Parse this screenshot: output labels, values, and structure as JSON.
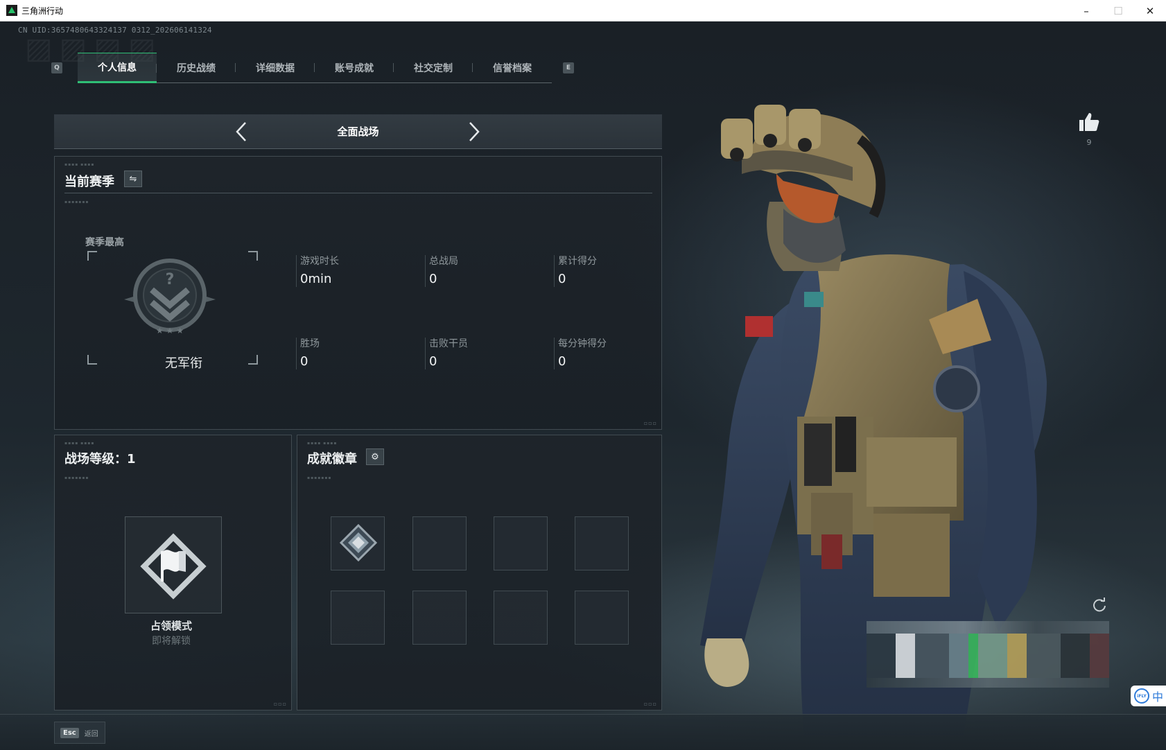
{
  "window": {
    "title": "三角洲行动",
    "controls": [
      "–",
      "☐",
      "✕"
    ]
  },
  "uid": "CN UID:3657480643324137 0312_202606141324",
  "tabs": {
    "left_key": "Q",
    "right_key": "E",
    "items": [
      {
        "label": "个人信息",
        "active": true
      },
      {
        "label": "历史战绩",
        "active": false
      },
      {
        "label": "详细数据",
        "active": false
      },
      {
        "label": "账号成就",
        "active": false
      },
      {
        "label": "社交定制",
        "active": false
      },
      {
        "label": "信誉档案",
        "active": false
      }
    ]
  },
  "mode_selector": {
    "title": "全面战场"
  },
  "season": {
    "title": "当前赛季",
    "best_label": "赛季最高",
    "rank_name": "无军衔",
    "stats": [
      {
        "label": "游戏时长",
        "value": "0min"
      },
      {
        "label": "总战局",
        "value": "0"
      },
      {
        "label": "累计得分",
        "value": "0"
      },
      {
        "label": "胜场",
        "value": "0"
      },
      {
        "label": "击败干员",
        "value": "0"
      },
      {
        "label": "每分钟得分",
        "value": "0"
      }
    ]
  },
  "level": {
    "title": "战场等级：1",
    "mode_name": "占领模式",
    "mode_status": "即将解锁"
  },
  "badges": {
    "title": "成就徽章",
    "slots": 8,
    "filled": 1
  },
  "operator": {
    "likes": "9"
  },
  "ime": {
    "logo": "iFLY",
    "text": "中"
  },
  "bottom": {
    "esc_key": "Esc",
    "esc_label": "返回"
  },
  "colors": {
    "accent": "#2fbf76",
    "panel_border": "#414b51",
    "background": "#1b2228"
  }
}
